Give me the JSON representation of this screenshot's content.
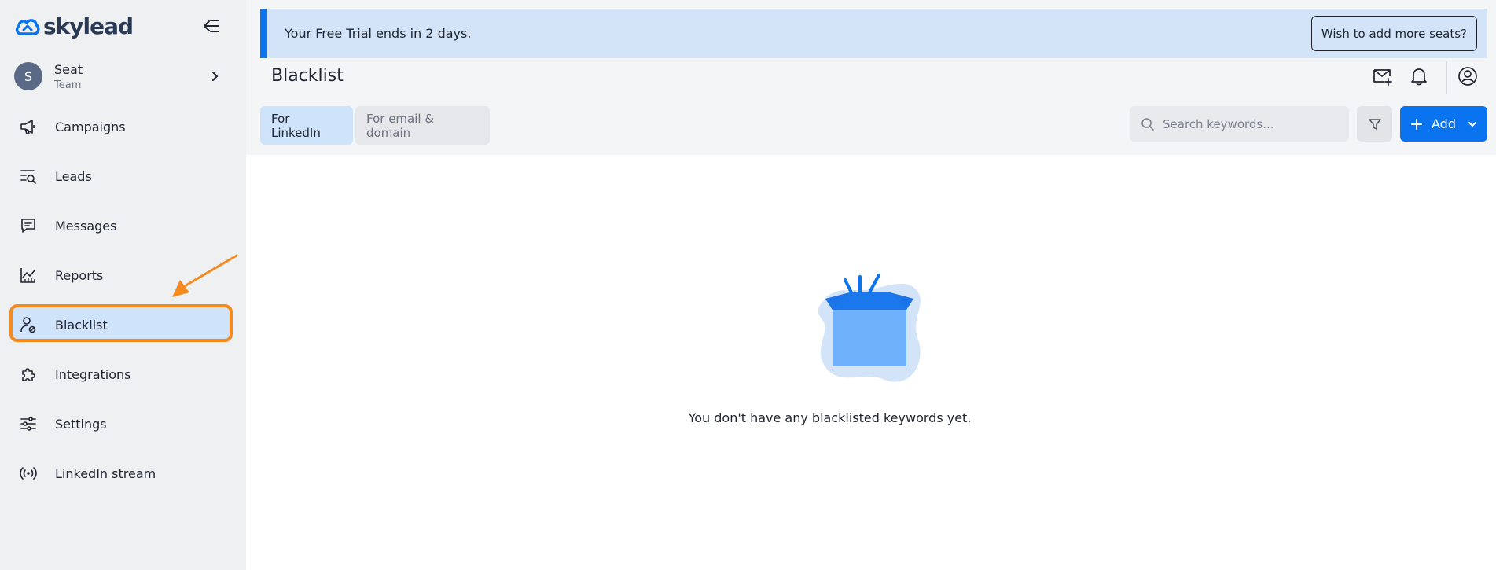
{
  "app": {
    "logo_text": "skylead"
  },
  "seat": {
    "initial": "S",
    "name": "Seat",
    "subtitle": "Team"
  },
  "sidebar": {
    "items": [
      {
        "label": "Campaigns",
        "icon": "megaphone-icon"
      },
      {
        "label": "Leads",
        "icon": "lead-search-icon"
      },
      {
        "label": "Messages",
        "icon": "message-icon"
      },
      {
        "label": "Reports",
        "icon": "chart-icon"
      },
      {
        "label": "Blacklist",
        "icon": "user-block-icon",
        "active": true
      },
      {
        "label": "Integrations",
        "icon": "puzzle-icon"
      },
      {
        "label": "Settings",
        "icon": "sliders-icon"
      },
      {
        "label": "LinkedIn stream",
        "icon": "broadcast-icon"
      }
    ]
  },
  "banner": {
    "text": "Your Free Trial ends in 2 days.",
    "button": "Wish to add more seats?"
  },
  "header": {
    "title": "Blacklist"
  },
  "tabs": [
    {
      "label": "For LinkedIn",
      "active": true
    },
    {
      "label": "For email & domain",
      "active": false
    }
  ],
  "search": {
    "placeholder": "Search keywords...",
    "value": ""
  },
  "add_button": {
    "label": "Add"
  },
  "empty_state": {
    "text": "You don't have any blacklisted keywords yet."
  },
  "colors": {
    "accent": "#0a74f0",
    "highlight": "#f58a1f",
    "active_bg": "#cfe3fb"
  }
}
